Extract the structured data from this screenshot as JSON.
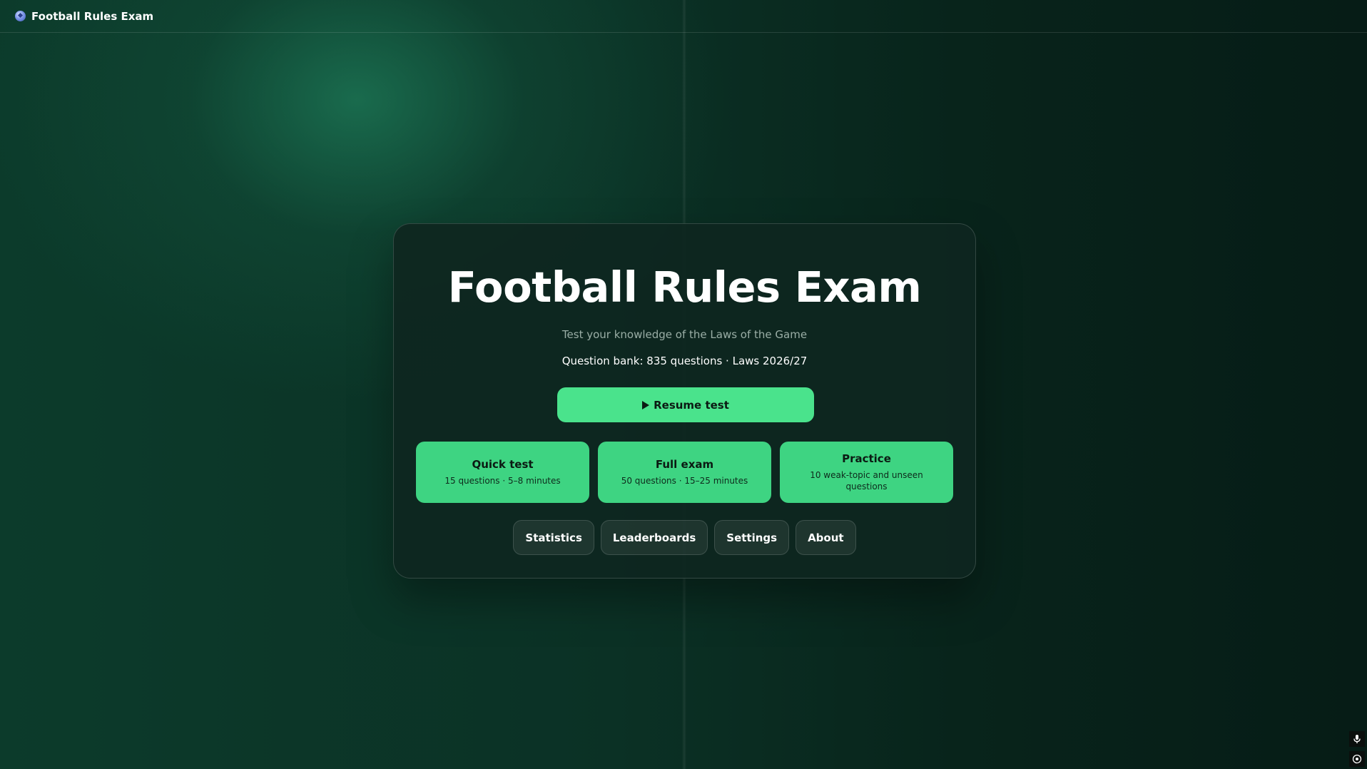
{
  "topbar": {
    "brand_icon": "soccer-ball-icon",
    "brand_name": "Football Rules Exam"
  },
  "hero": {
    "title": "Football Rules Exam",
    "subtitle": "Test your knowledge of the Laws of the Game",
    "meta": "Question bank: 835 questions · Laws 2026/27"
  },
  "resume": {
    "icon": "play-icon",
    "label": "Resume test"
  },
  "modes": [
    {
      "title": "Quick test",
      "desc": "15 questions · 5–8 minutes"
    },
    {
      "title": "Full exam",
      "desc": "50 questions · 15–25 minutes"
    },
    {
      "title": "Practice",
      "desc": "10 weak-topic and unseen questions"
    }
  ],
  "nav": [
    "Statistics",
    "Leaderboards",
    "Settings",
    "About"
  ],
  "tools": [
    "microphone-icon",
    "accessibility-icon"
  ],
  "colors": {
    "accent": "#4ae38c",
    "mode_card": "#3ed482",
    "background": "#0b3125",
    "card": "#0e2620"
  }
}
